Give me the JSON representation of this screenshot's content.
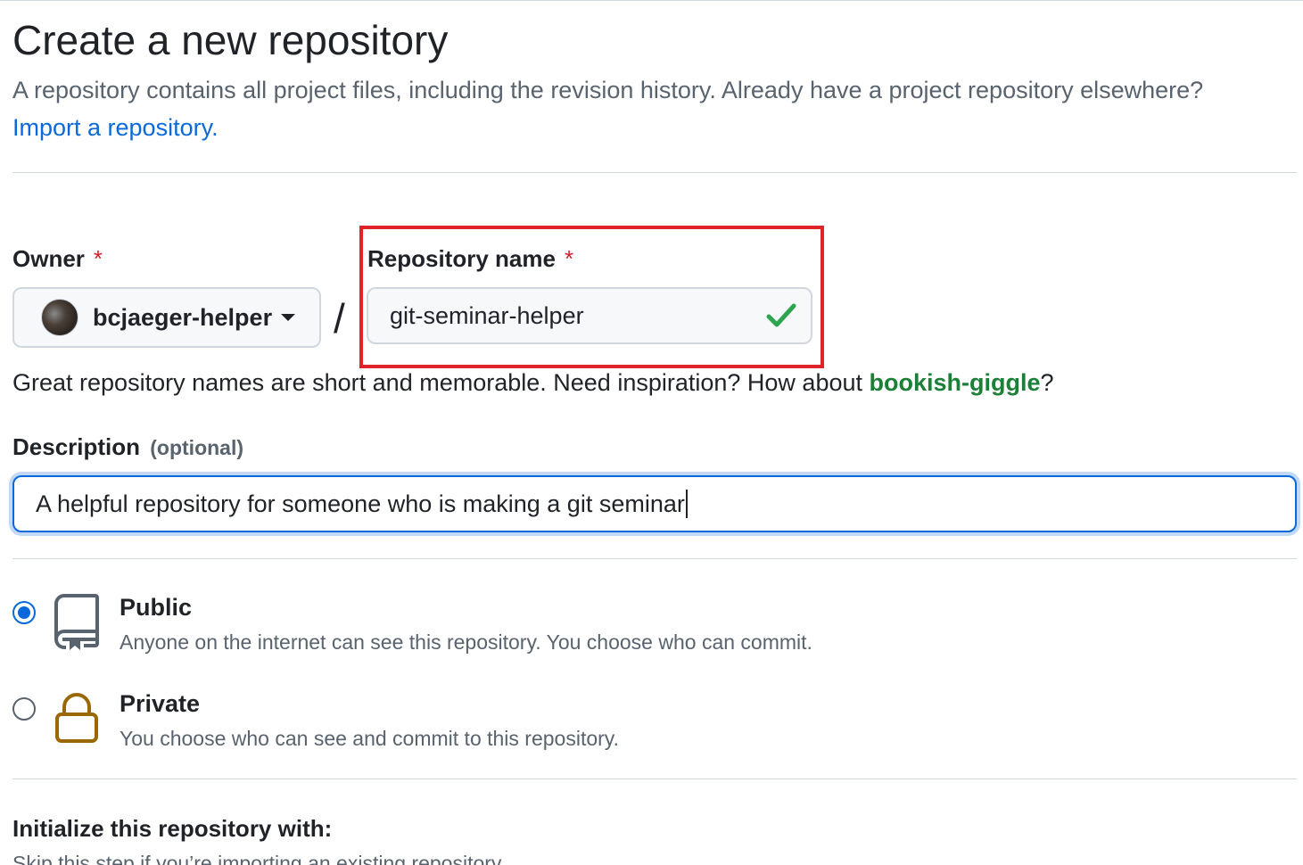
{
  "page": {
    "title": "Create a new repository",
    "subtitle": "A repository contains all project files, including the revision history. Already have a project repository elsewhere?",
    "import_link": "Import a repository."
  },
  "owner": {
    "label": "Owner",
    "required_mark": "*",
    "value": "bcjaeger-helper"
  },
  "separator": "/",
  "repository_name": {
    "label": "Repository name",
    "required_mark": "*",
    "value": "git-seminar-helper"
  },
  "name_hint": {
    "text": "Great repository names are short and memorable. Need inspiration? How about ",
    "suggestion": "bookish-giggle",
    "suffix": "?"
  },
  "description": {
    "label": "Description",
    "optional": "(optional)",
    "value": "A helpful repository for someone who is making a git seminar"
  },
  "visibility": {
    "options": [
      {
        "label": "Public",
        "description": "Anyone on the internet can see this repository. You choose who can commit.",
        "icon": "repo-icon",
        "checked": true
      },
      {
        "label": "Private",
        "description": "You choose who can see and commit to this repository.",
        "icon": "lock-icon",
        "checked": false
      }
    ]
  },
  "initialize": {
    "title": "Initialize this repository with:",
    "description": "Skip this step if you’re importing an existing repository."
  },
  "colors": {
    "accent": "#0969da",
    "success": "#1a7f37",
    "danger": "#cf222e",
    "highlight": "#e0232b",
    "private_icon": "#9a6700"
  }
}
